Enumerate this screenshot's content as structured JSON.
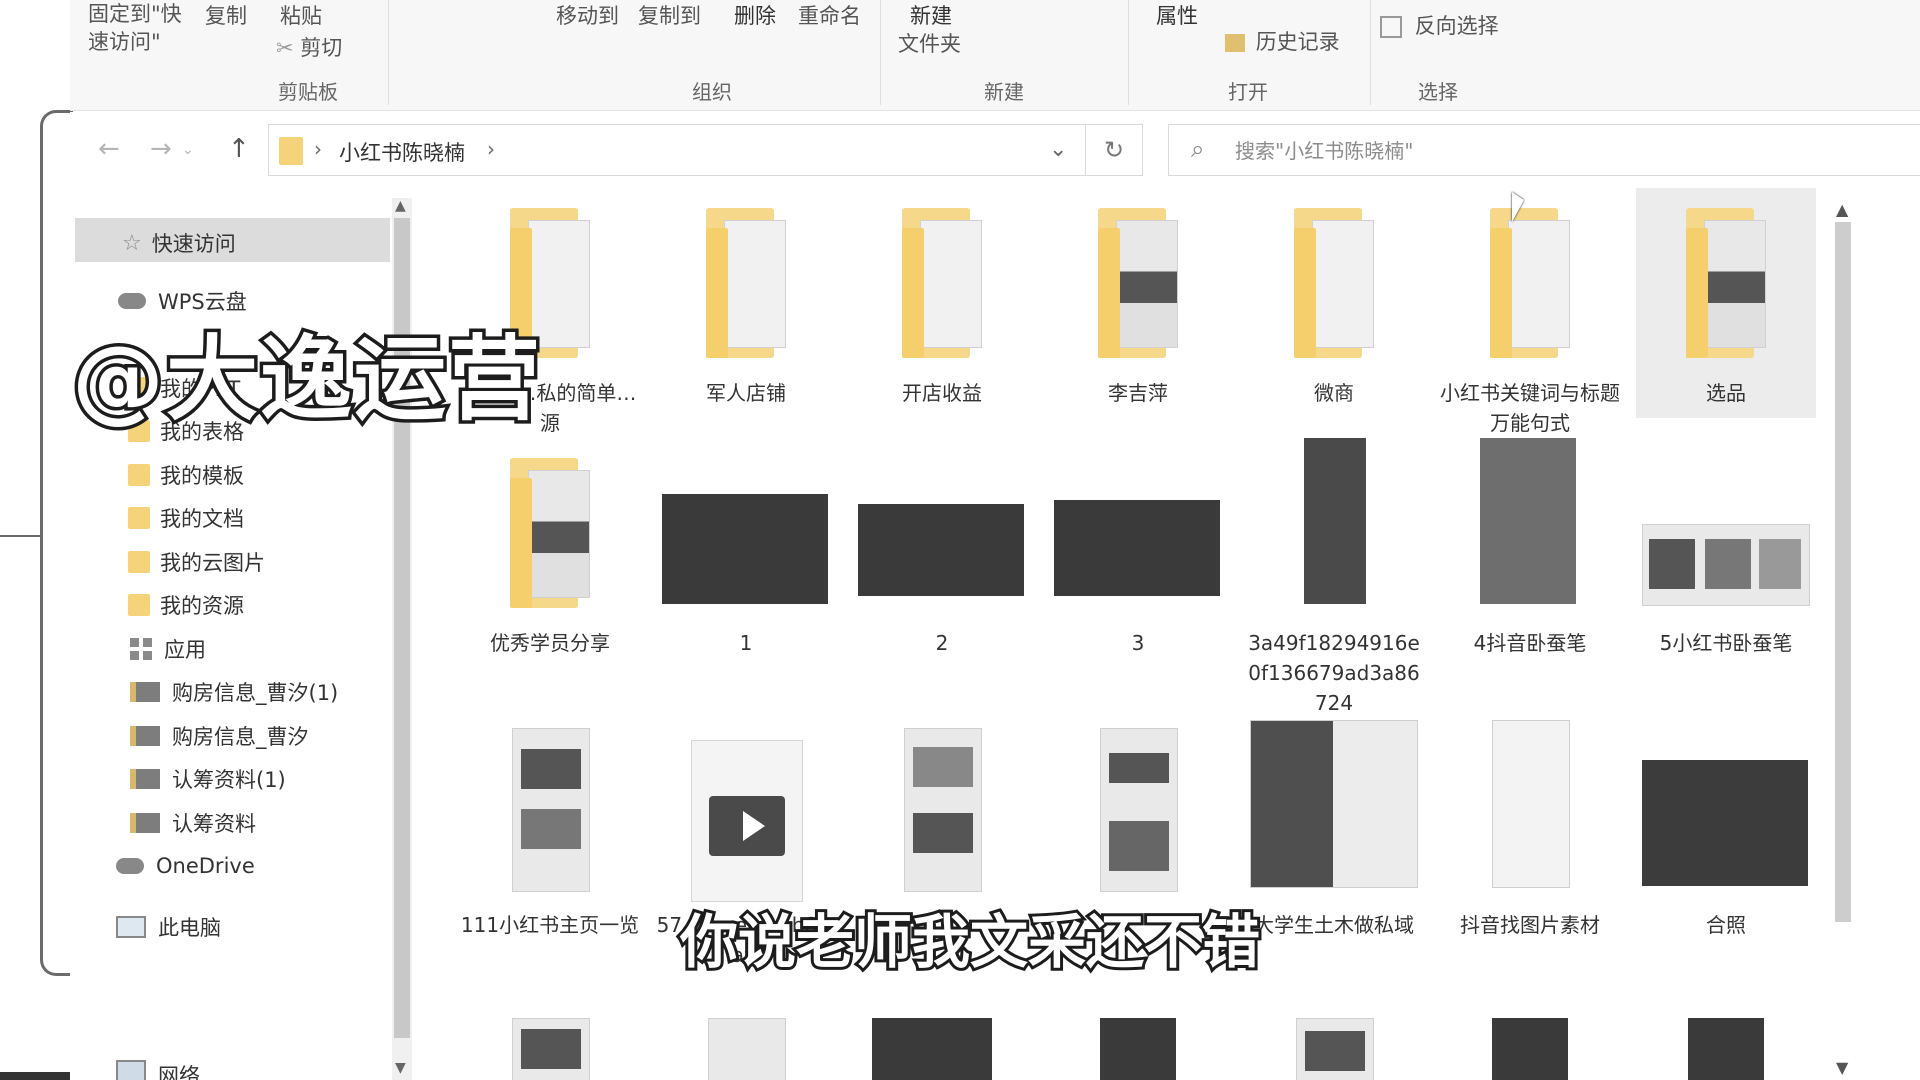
{
  "ribbon": {
    "clipboard": {
      "pin_quick_access": "固定到\"快\n速访问\"",
      "copy": "复制",
      "paste": "粘贴",
      "cut": "剪切",
      "group_label": "剪贴板"
    },
    "organize": {
      "move_to": "移动到",
      "copy_to": "复制到",
      "delete": "删除",
      "rename": "重命名",
      "group_label": "组织"
    },
    "new": {
      "new_folder_line1": "新建",
      "new_folder_line2": "文件夹",
      "group_label": "新建"
    },
    "open": {
      "properties": "属性",
      "history": "历史记录",
      "group_label": "打开"
    },
    "select": {
      "invert_selection": "反向选择",
      "group_label": "选择"
    }
  },
  "navigation": {
    "back_icon": "arrow-left",
    "forward_icon": "arrow-right",
    "up_icon": "arrow-up",
    "breadcrumb": "小红书陈晓楠",
    "search_placeholder": "搜索\"小红书陈晓楠\""
  },
  "nav_pane": {
    "quick_access": "快速访问",
    "wps_cloud": "WPS云盘",
    "items": [
      {
        "label": "我的PPT",
        "icon": "folder"
      },
      {
        "label": "我的表格",
        "icon": "folder"
      },
      {
        "label": "我的模板",
        "icon": "folder"
      },
      {
        "label": "我的文档",
        "icon": "folder"
      },
      {
        "label": "我的云图片",
        "icon": "folder"
      },
      {
        "label": "我的资源",
        "icon": "folder"
      },
      {
        "label": "应用",
        "icon": "apps"
      },
      {
        "label": "购房信息_曹汐(1)",
        "icon": "doc-folder"
      },
      {
        "label": "购房信息_曹汐",
        "icon": "doc-folder"
      },
      {
        "label": "认筹资料(1)",
        "icon": "doc-folder"
      },
      {
        "label": "认筹资料",
        "icon": "doc-folder"
      }
    ],
    "onedrive": "OneDrive",
    "this_pc": "此电脑",
    "network": "网络"
  },
  "files": {
    "row1": [
      {
        "label": "0玩可…私的简单…源",
        "type": "folder"
      },
      {
        "label": "军人店铺",
        "type": "folder"
      },
      {
        "label": "开店收益",
        "type": "folder"
      },
      {
        "label": "李吉萍",
        "type": "folder"
      },
      {
        "label": "微商",
        "type": "folder"
      },
      {
        "label": "小红书关键词与标题万能句式",
        "type": "folder"
      },
      {
        "label": "选品",
        "type": "folder",
        "selected": true
      }
    ],
    "row2": [
      {
        "label": "优秀学员分享",
        "type": "folder"
      },
      {
        "label": "1",
        "type": "image-wide"
      },
      {
        "label": "2",
        "type": "image-wide"
      },
      {
        "label": "3",
        "type": "image-wide"
      },
      {
        "label": "3a49f18294916e0f136679ad3a86724",
        "type": "image-tall"
      },
      {
        "label": "4抖音卧蚕笔",
        "type": "image-portrait"
      },
      {
        "label": "5小红书卧蚕笔",
        "type": "image-wide-light"
      }
    ],
    "row3": [
      {
        "label": "111小红书主页一览",
        "type": "image-phone"
      },
      {
        "label": "57…b…eafb1b8_raw",
        "type": "video"
      },
      {
        "label": "",
        "type": "image-phone"
      },
      {
        "label": "",
        "type": "image-phone"
      },
      {
        "label": "大学生土木做私域",
        "type": "image-chat"
      },
      {
        "label": "抖音找图片素材",
        "type": "image-phone"
      },
      {
        "label": "合照",
        "type": "image-photo"
      }
    ]
  },
  "overlay": {
    "watermark": "@大逸运营",
    "subtitle": "你说老师我文采还不错"
  },
  "colors": {
    "folder": "#f6d88a",
    "selection": "#dcdcdc"
  }
}
